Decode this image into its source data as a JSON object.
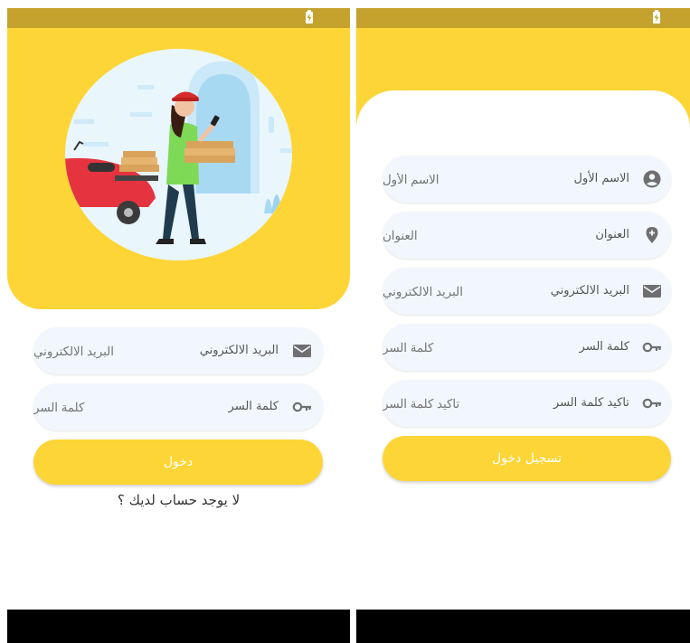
{
  "colors": {
    "accent": "#fdd536",
    "status_bar": "#c4a22d",
    "field_background": "#f1f7fd",
    "icon": "#6f6f6f",
    "nav_bar": "#000000"
  },
  "login": {
    "status_icon": "battery-charging-icon",
    "illustration": "delivery-woman-with-scooter",
    "email_field": {
      "placeholder": "البريد الالكتروني",
      "icon": "mail-icon"
    },
    "password_field": {
      "placeholder": "كلمة السر",
      "icon": "key-icon"
    },
    "login_button": "دخول",
    "signup_link": "لا يوجد حساب لديك ؟"
  },
  "register": {
    "status_icon": "battery-charging-icon",
    "fields": [
      {
        "placeholder": "الاسم الأول",
        "icon": "account-circle-icon"
      },
      {
        "placeholder": "العنوان",
        "icon": "location-plus-icon"
      },
      {
        "placeholder": "البريد الالكتروني",
        "icon": "mail-icon"
      },
      {
        "placeholder": "كلمة السر",
        "icon": "key-icon"
      },
      {
        "placeholder": "تاكيد كلمة السر",
        "icon": "key-icon"
      }
    ],
    "register_button": "تسجيل دخول"
  }
}
